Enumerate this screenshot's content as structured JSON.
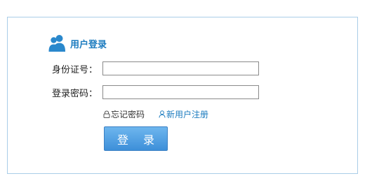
{
  "header": {
    "title": "用户登录",
    "icon": "users-icon",
    "accent_color": "#1b7bbf"
  },
  "form": {
    "id_label": "身份证号：",
    "id_value": "",
    "password_label": "登录密码：",
    "password_value": ""
  },
  "links": {
    "forgot_password": "忘记密码",
    "forgot_icon": "lock-icon",
    "register": "新用户注册",
    "register_icon": "user-icon"
  },
  "actions": {
    "login_label": "登 录"
  },
  "colors": {
    "panel_border": "#a9cde8",
    "button_top": "#6eb6ee",
    "button_bottom": "#3d8fd9"
  }
}
